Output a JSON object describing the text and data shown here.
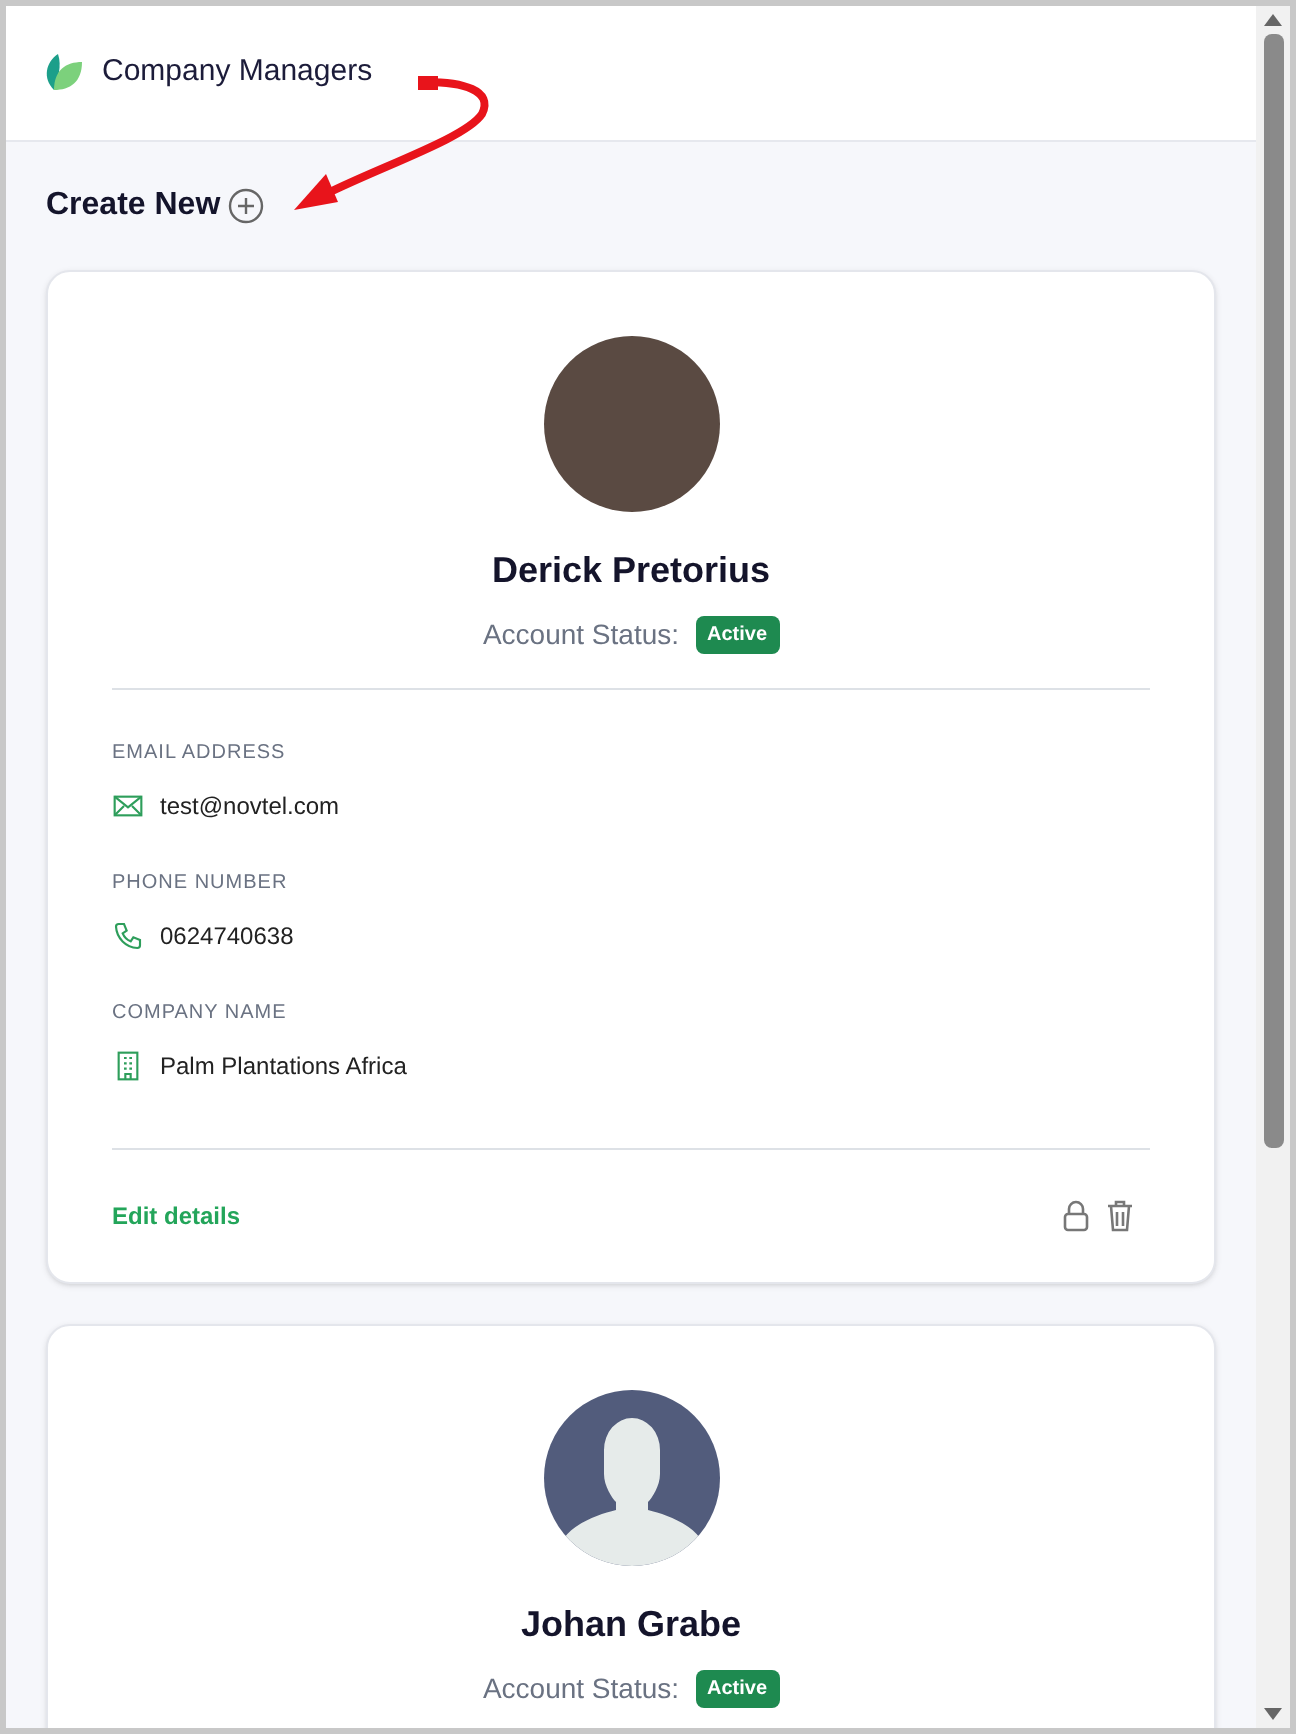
{
  "header": {
    "title": "Company Managers"
  },
  "create_new": {
    "label": "Create New"
  },
  "managers": [
    {
      "avatar": {
        "kind": "photo"
      },
      "name": "Derick Pretorius",
      "status_label": "Account Status:",
      "status": {
        "text": "Active",
        "kind": "active"
      },
      "fields": [
        {
          "kind": "email",
          "label": "EMAIL ADDRESS",
          "value": "test@novtel.com"
        },
        {
          "kind": "phone",
          "label": "PHONE NUMBER",
          "value": "0624740638"
        },
        {
          "kind": "company",
          "label": "COMPANY NAME",
          "value": "Palm Plantations Africa"
        }
      ],
      "edit_label": "Edit details"
    },
    {
      "avatar": {
        "kind": "silhouette"
      },
      "name": "Johan Grabe",
      "status_label": "Account Status:",
      "status": {
        "text": "Active",
        "kind": "active"
      }
    }
  ]
}
